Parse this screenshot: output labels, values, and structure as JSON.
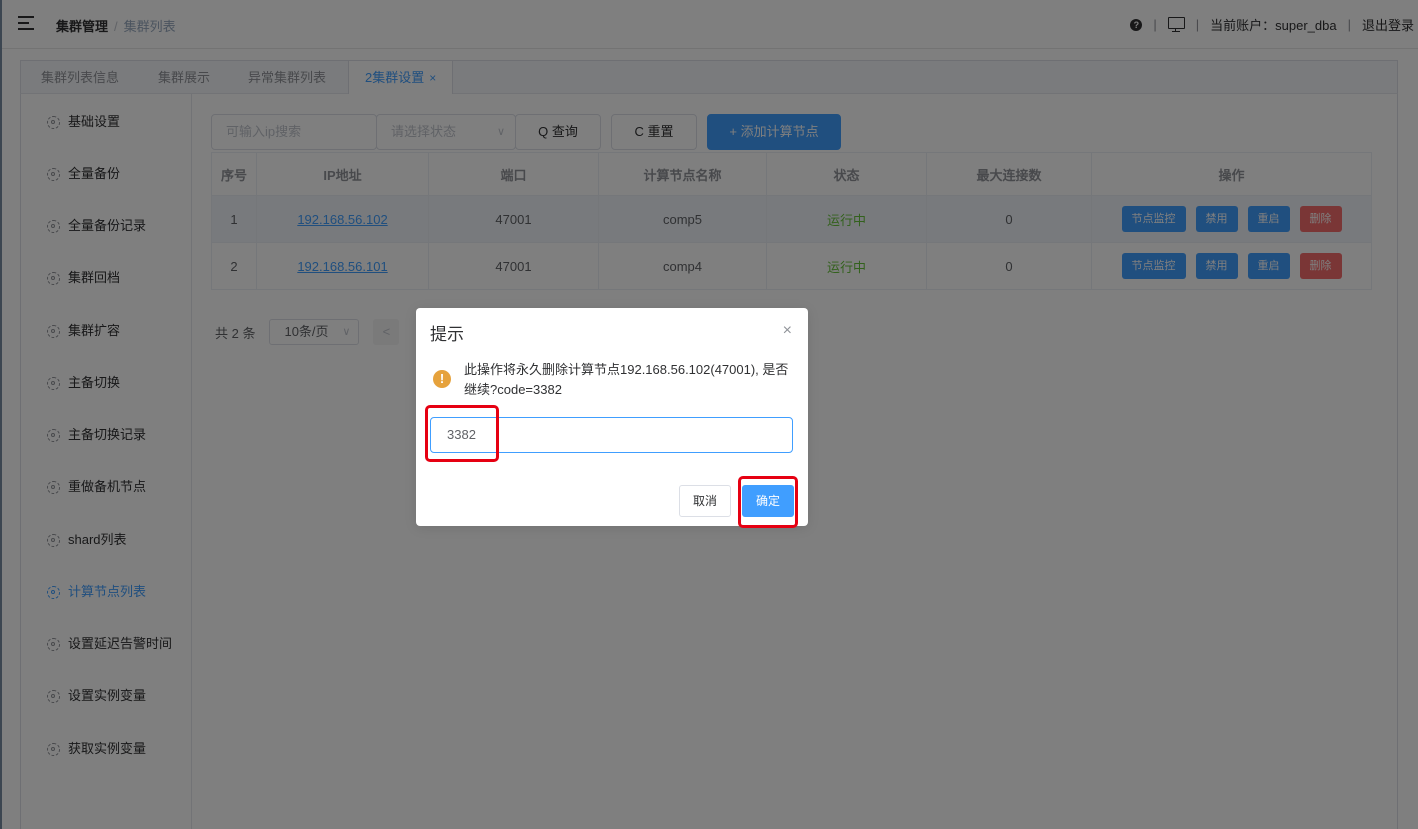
{
  "header": {
    "breadcrumb_current": "集群管理",
    "breadcrumb_separator": "/",
    "breadcrumb_link": "集群列表",
    "account_text": "当前账户：super_dba",
    "logout_label": "退出登录",
    "divider": "|"
  },
  "tabs": [
    {
      "label": "集群列表信息"
    },
    {
      "label": "集群展示"
    },
    {
      "label": "异常集群列表"
    },
    {
      "label": "2集群设置",
      "close": "×"
    }
  ],
  "sidebar": {
    "items": [
      {
        "label": "基础设置"
      },
      {
        "label": "全量备份"
      },
      {
        "label": "全量备份记录"
      },
      {
        "label": "集群回档"
      },
      {
        "label": "集群扩容"
      },
      {
        "label": "主备切换"
      },
      {
        "label": "主备切换记录"
      },
      {
        "label": "重做备机节点"
      },
      {
        "label": "shard列表"
      },
      {
        "label": "计算节点列表"
      },
      {
        "label": "设置延迟告警时间"
      },
      {
        "label": "设置实例变量"
      },
      {
        "label": "获取实例变量"
      }
    ]
  },
  "toolbar": {
    "ip_placeholder": "可输入ip搜索",
    "status_placeholder": "请选择状态",
    "query_label": "Q 查询",
    "reset_label": "C 重置",
    "add_label": "+ 添加计算节点"
  },
  "table": {
    "columns": [
      "序号",
      "IP地址",
      "端口",
      "计算节点名称",
      "状态",
      "最大连接数",
      "操作"
    ],
    "rows": [
      {
        "index": "1",
        "ip": "192.168.56.102",
        "port": "47001",
        "name": "comp5",
        "status": "运行中",
        "max_conn": "0"
      },
      {
        "index": "2",
        "ip": "192.168.56.101",
        "port": "47001",
        "name": "comp4",
        "status": "运行中",
        "max_conn": "0"
      }
    ],
    "actions": {
      "monitor": "节点监控",
      "disable": "禁用",
      "restart": "重启",
      "delete": "删除"
    }
  },
  "pagination": {
    "total": "共 2 条",
    "page_size": "10条/页",
    "prev": "<"
  },
  "dialog": {
    "title": "提示",
    "close": "×",
    "message": "此操作将永久删除计算节点192.168.56.102(47001), 是否继续?code=3382",
    "input_value": "3382",
    "cancel_label": "取消",
    "confirm_label": "确定"
  },
  "colors": {
    "primary": "#409eff",
    "success": "#67c23a",
    "danger": "#f56c6c",
    "warning": "#e6a23c",
    "annotation": "#e60012"
  }
}
